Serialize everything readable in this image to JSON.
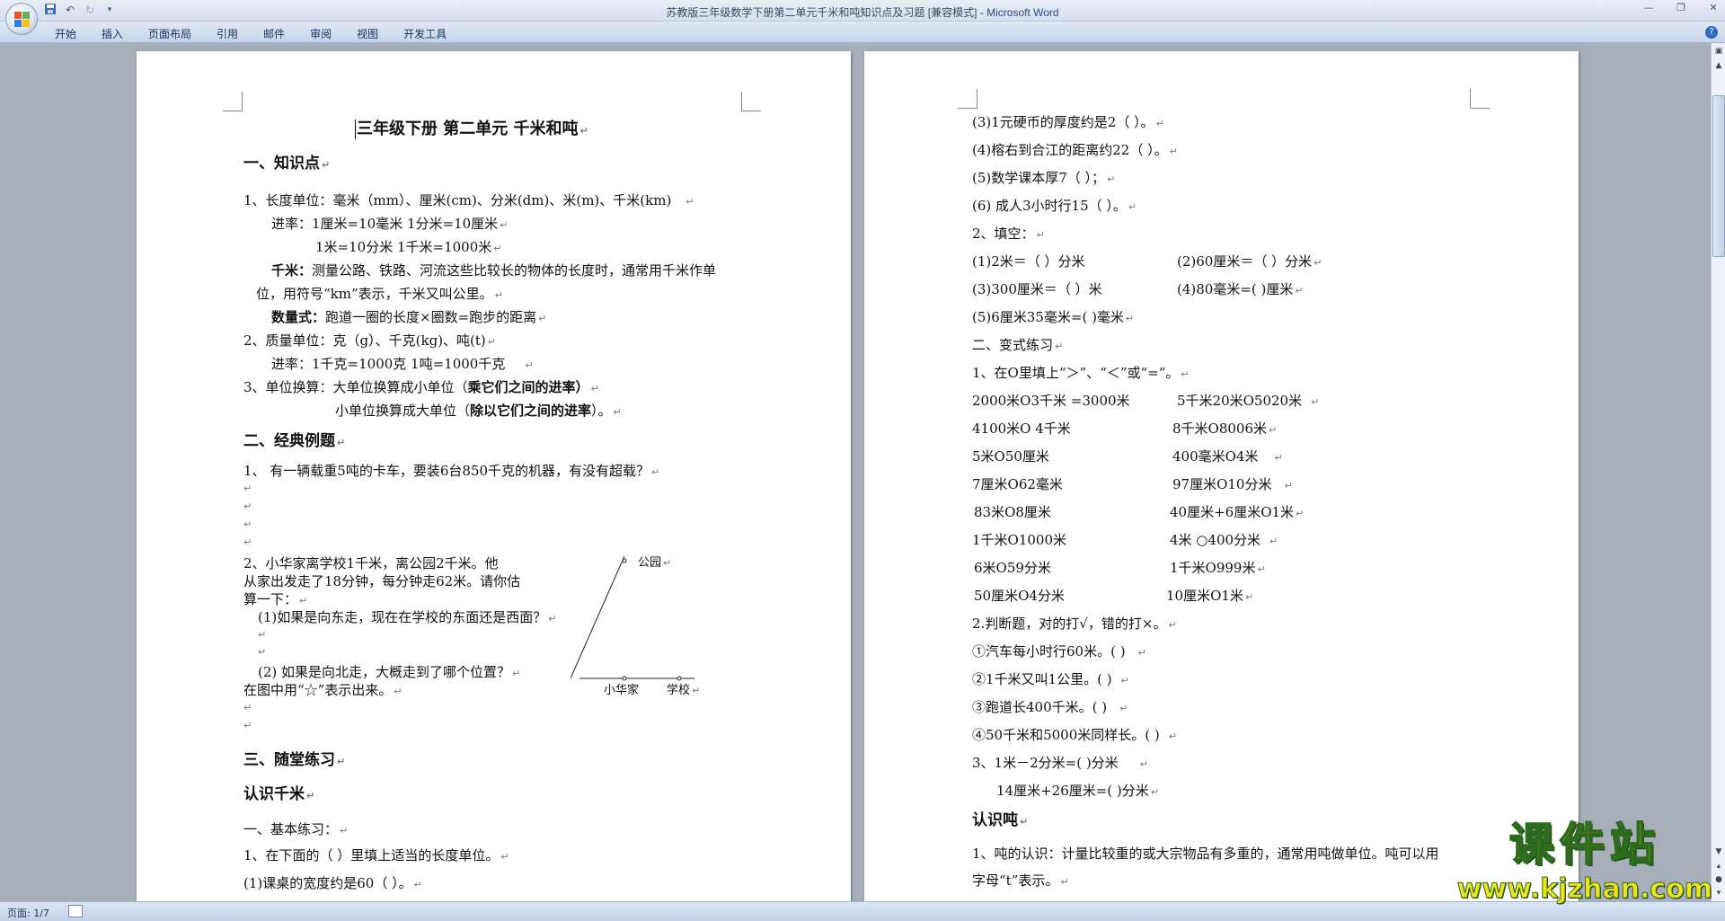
{
  "window": {
    "title": "苏教版三年级数学下册第二单元千米和吨知识点及习题 [兼容模式]",
    "app_separator": " - ",
    "app_name": "Microsoft Word"
  },
  "quick_access": {
    "icons": [
      "save-icon",
      "undo-icon",
      "redo-icon",
      "customize-icon"
    ]
  },
  "ribbon": {
    "tabs": [
      "开始",
      "插入",
      "页面布局",
      "引用",
      "邮件",
      "审阅",
      "视图",
      "开发工具"
    ]
  },
  "statusbar": {
    "page_info": "页面: 1/7"
  },
  "watermark": {
    "text": "课件站",
    "url": "www.kjzhan.com"
  },
  "doc": {
    "left": {
      "title": "三年级下册  第二单元  千米和吨",
      "s1_heading": "一、知识点",
      "p1": "1、长度单位：毫米（mm）、厘米(cm)、分米(dm)、米(m)、千米(km)",
      "p2": "进率：1厘米=10毫米          1分米=10厘米",
      "p3": "1米=10分米          1千米=1000米",
      "p4_bold": "千米：",
      "p4": "测量公路、铁路、河流这些比较长的物体的长度时，通常用千米作单",
      "p5": "位，用符号“km”表示，千米又叫公里。",
      "p6_bold": "数量式：",
      "p6": "跑道一圈的长度×圈数=跑步的距离",
      "p7": "2、质量单位：克（g）、千克(kg)、吨(t)",
      "p8": "进率：1千克=1000克            1吨=1000千克",
      "p9": "3、单位换算：大单位换算成小单位（",
      "p9_bold": "乘它们之间的进率）",
      "p10": "小单位换算成大单位（",
      "p10_bold": "除以它们之间的进率",
      "p10_end": "）。",
      "s2_heading": "二、经典例题",
      "e1": "1、 有一辆载重5吨的卡车，要装6台850千克的机器，有没有超载？",
      "e2a": "2、小华家离学校1千米，离公园2千米。他",
      "e2b": "从家出发走了18分钟，每分钟走62米。请你估",
      "e2c": "算一下：",
      "e2d": "(1)如果是向东走，现在在学校的东面还是西面？",
      "e2e": "(2) 如果是向北走，大概走到了哪个位置？",
      "e2f": "在图中用“☆”表示出来。",
      "map_park": "公园",
      "map_home": "小华家",
      "map_school": "学校",
      "s3_heading": "三、随堂练习",
      "s3_sub": "认识千米",
      "s3_a": "一、基本练习：",
      "s3_b": "1、在下面的（ ）里填上适当的长度单位。",
      "s3_c": "(1)课桌的宽度约是60（       ）。"
    },
    "right": {
      "r1": "(3)1元硬币的厚度约是2（        ）。",
      "r2": "(4)榕右到合江的距离约22（          ）。",
      "r3": "(5)数学课本厚7（         ）；",
      "r4": "(6) 成人3小时行15（         ）。",
      "r5": "2、填空：",
      "r6a": "(1)2米＝（       ）分米",
      "r6b": "(2)60厘米＝（      ）分米",
      "r7a": "(3)300厘米＝（         ）米",
      "r7b": "(4)80毫米=(          )厘米",
      "r8": "(5)6厘米35毫米=(   )毫米",
      "r9": "二、变式练习",
      "r10": "1、在O里填上“＞”、“＜”或“=”。",
      "c1a": "2000米O3千米 =3000米",
      "c1b": "5千米20米O5020米",
      "c2a": "4100米O 4千米",
      "c2b": "8千米O8006米",
      "c3a": "5米O50厘米",
      "c3b": "400毫米O4米",
      "c4a": "7厘米O62毫米",
      "c4b": "97厘米O10分米",
      "c5a": "83米O8厘米",
      "c5b": "40厘米+6厘米O1米",
      "c6a": "1千米O1000米",
      "c6b": "4米 ○400分米",
      "c7a": "6米O59分米",
      "c7b": "1千米O999米",
      "c8a": "50厘米O4分米",
      "c8b": "10厘米O1米",
      "j0": "2.判断题，对的打√，错的打×。",
      "j1": "①汽车每小时行60米。(      )",
      "j2": "②1千米又叫1公里。(      )",
      "j3": "③跑道长400千米。(       )",
      "j4": "④50千米和5000米同样长。(      )",
      "k1": "3、1米－2分米=(       )分米",
      "k2": "14厘米+26厘米=(      )分米",
      "t_heading": "认识吨",
      "t1": "1、吨的认识：计量比较重的或大宗物品有多重的，通常用吨做单位。吨可以用",
      "t2": "字母“t”表示。"
    }
  }
}
